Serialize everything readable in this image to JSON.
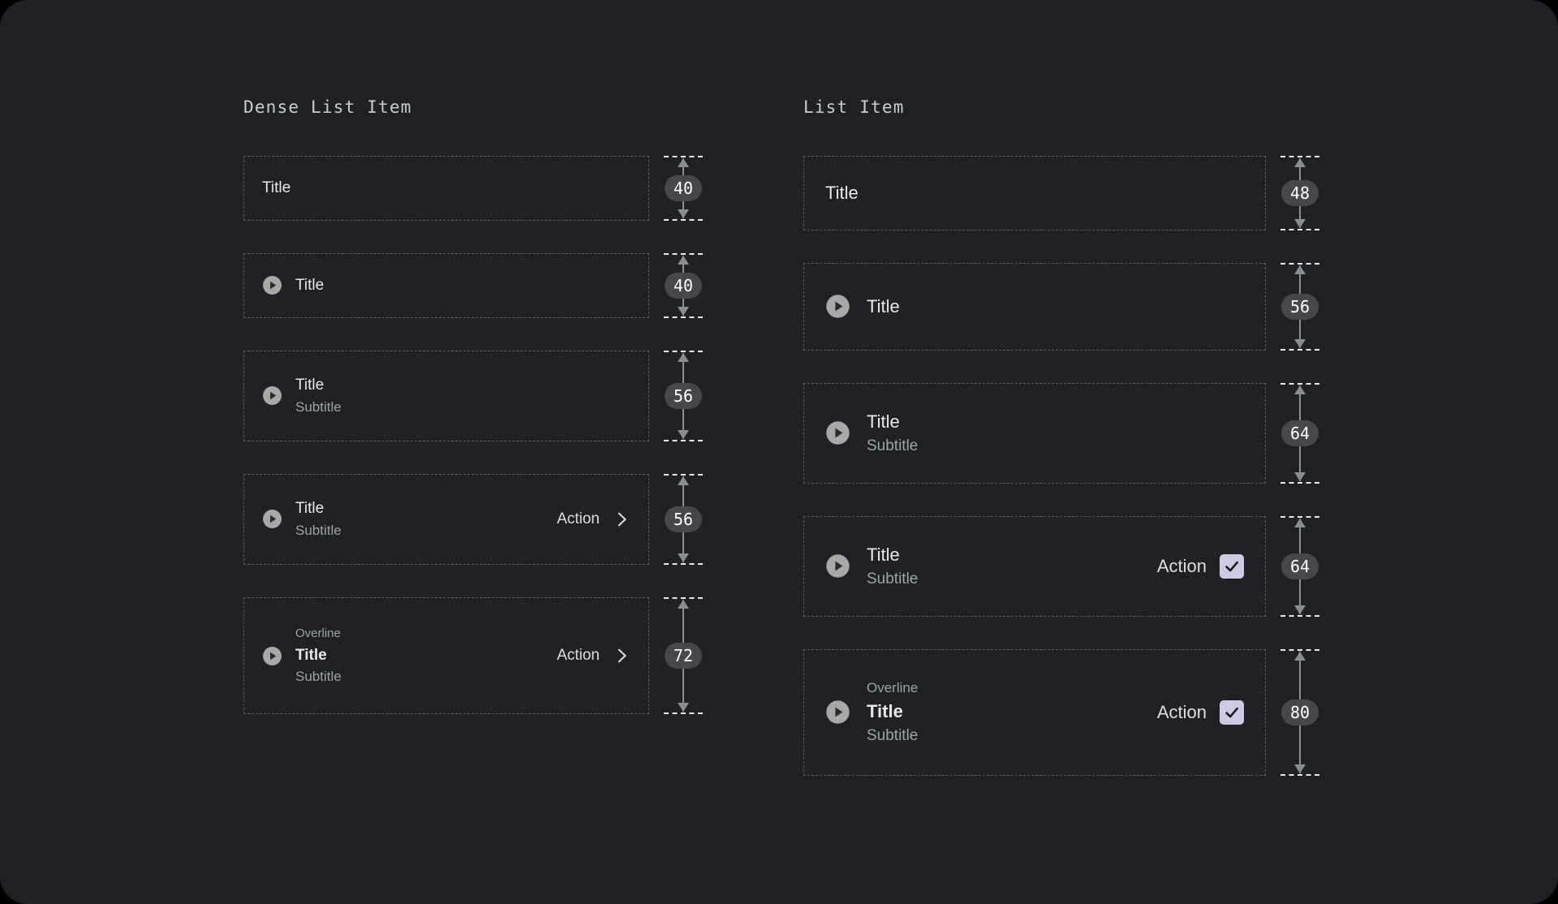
{
  "columns": [
    {
      "key": "dense",
      "heading": "Dense List Item",
      "rows": [
        {
          "measure": "40",
          "has_icon": false,
          "overline": null,
          "title": "Title",
          "subtitle": null,
          "action_label": null,
          "action_icon": null
        },
        {
          "measure": "40",
          "has_icon": true,
          "overline": null,
          "title": "Title",
          "subtitle": null,
          "action_label": null,
          "action_icon": null
        },
        {
          "measure": "56",
          "has_icon": true,
          "overline": null,
          "title": "Title",
          "subtitle": "Subtitle",
          "action_label": null,
          "action_icon": null
        },
        {
          "measure": "56",
          "has_icon": true,
          "overline": null,
          "title": "Title",
          "subtitle": "Subtitle",
          "action_label": "Action",
          "action_icon": "chevron-right-icon"
        },
        {
          "measure": "72",
          "has_icon": true,
          "overline": "Overline",
          "title": "Title",
          "subtitle": "Subtitle",
          "action_label": "Action",
          "action_icon": "chevron-right-icon"
        }
      ]
    },
    {
      "key": "regular",
      "heading": "List Item",
      "rows": [
        {
          "measure": "48",
          "has_icon": false,
          "overline": null,
          "title": "Title",
          "subtitle": null,
          "action_label": null,
          "action_icon": null
        },
        {
          "measure": "56",
          "has_icon": true,
          "overline": null,
          "title": "Title",
          "subtitle": null,
          "action_label": null,
          "action_icon": null
        },
        {
          "measure": "64",
          "has_icon": true,
          "overline": null,
          "title": "Title",
          "subtitle": "Subtitle",
          "action_label": null,
          "action_icon": null
        },
        {
          "measure": "64",
          "has_icon": true,
          "overline": null,
          "title": "Title",
          "subtitle": "Subtitle",
          "action_label": "Action",
          "action_icon": "checkbox-checked-icon"
        },
        {
          "measure": "80",
          "has_icon": true,
          "overline": "Overline",
          "title": "Title",
          "subtitle": "Subtitle",
          "action_label": "Action",
          "action_icon": "checkbox-checked-icon"
        }
      ]
    }
  ],
  "icons": {
    "leading": "play-circle-icon"
  },
  "colors": {
    "page_background": "#000000",
    "card_background": "#1f2124",
    "spec_border": "#585b60",
    "badge_background": "#45474a",
    "badge_text": "#ffffff",
    "title_text": "#e6e8ea",
    "secondary_text": "#9fa3a9",
    "heading_text": "#c9ccd1",
    "play_icon": "#a8a8a8",
    "checkbox_fill": "#cfcae3",
    "arrow": "#8b8e93",
    "cap": "#e9eaec"
  }
}
